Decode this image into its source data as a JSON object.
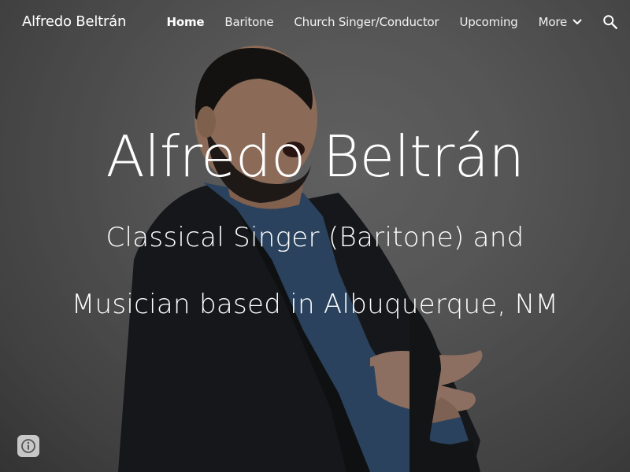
{
  "site": {
    "title": "Alfredo Beltrán"
  },
  "nav": {
    "items": [
      {
        "label": "Home",
        "active": true
      },
      {
        "label": "Baritone",
        "active": false
      },
      {
        "label": "Church Singer/Conductor",
        "active": false
      },
      {
        "label": "Upcoming",
        "active": false
      },
      {
        "label": "More",
        "active": false,
        "icon": "chevron-down-icon"
      }
    ],
    "search_icon": "search-icon"
  },
  "hero": {
    "heading": "Alfredo Beltrán",
    "subheading": "Classical Singer (Baritone) and Musician based in Albuquerque, NM"
  },
  "footer": {
    "info_icon": "info-icon"
  },
  "colors": {
    "text": "#ffffff",
    "backdrop": "#6b6b6b"
  }
}
